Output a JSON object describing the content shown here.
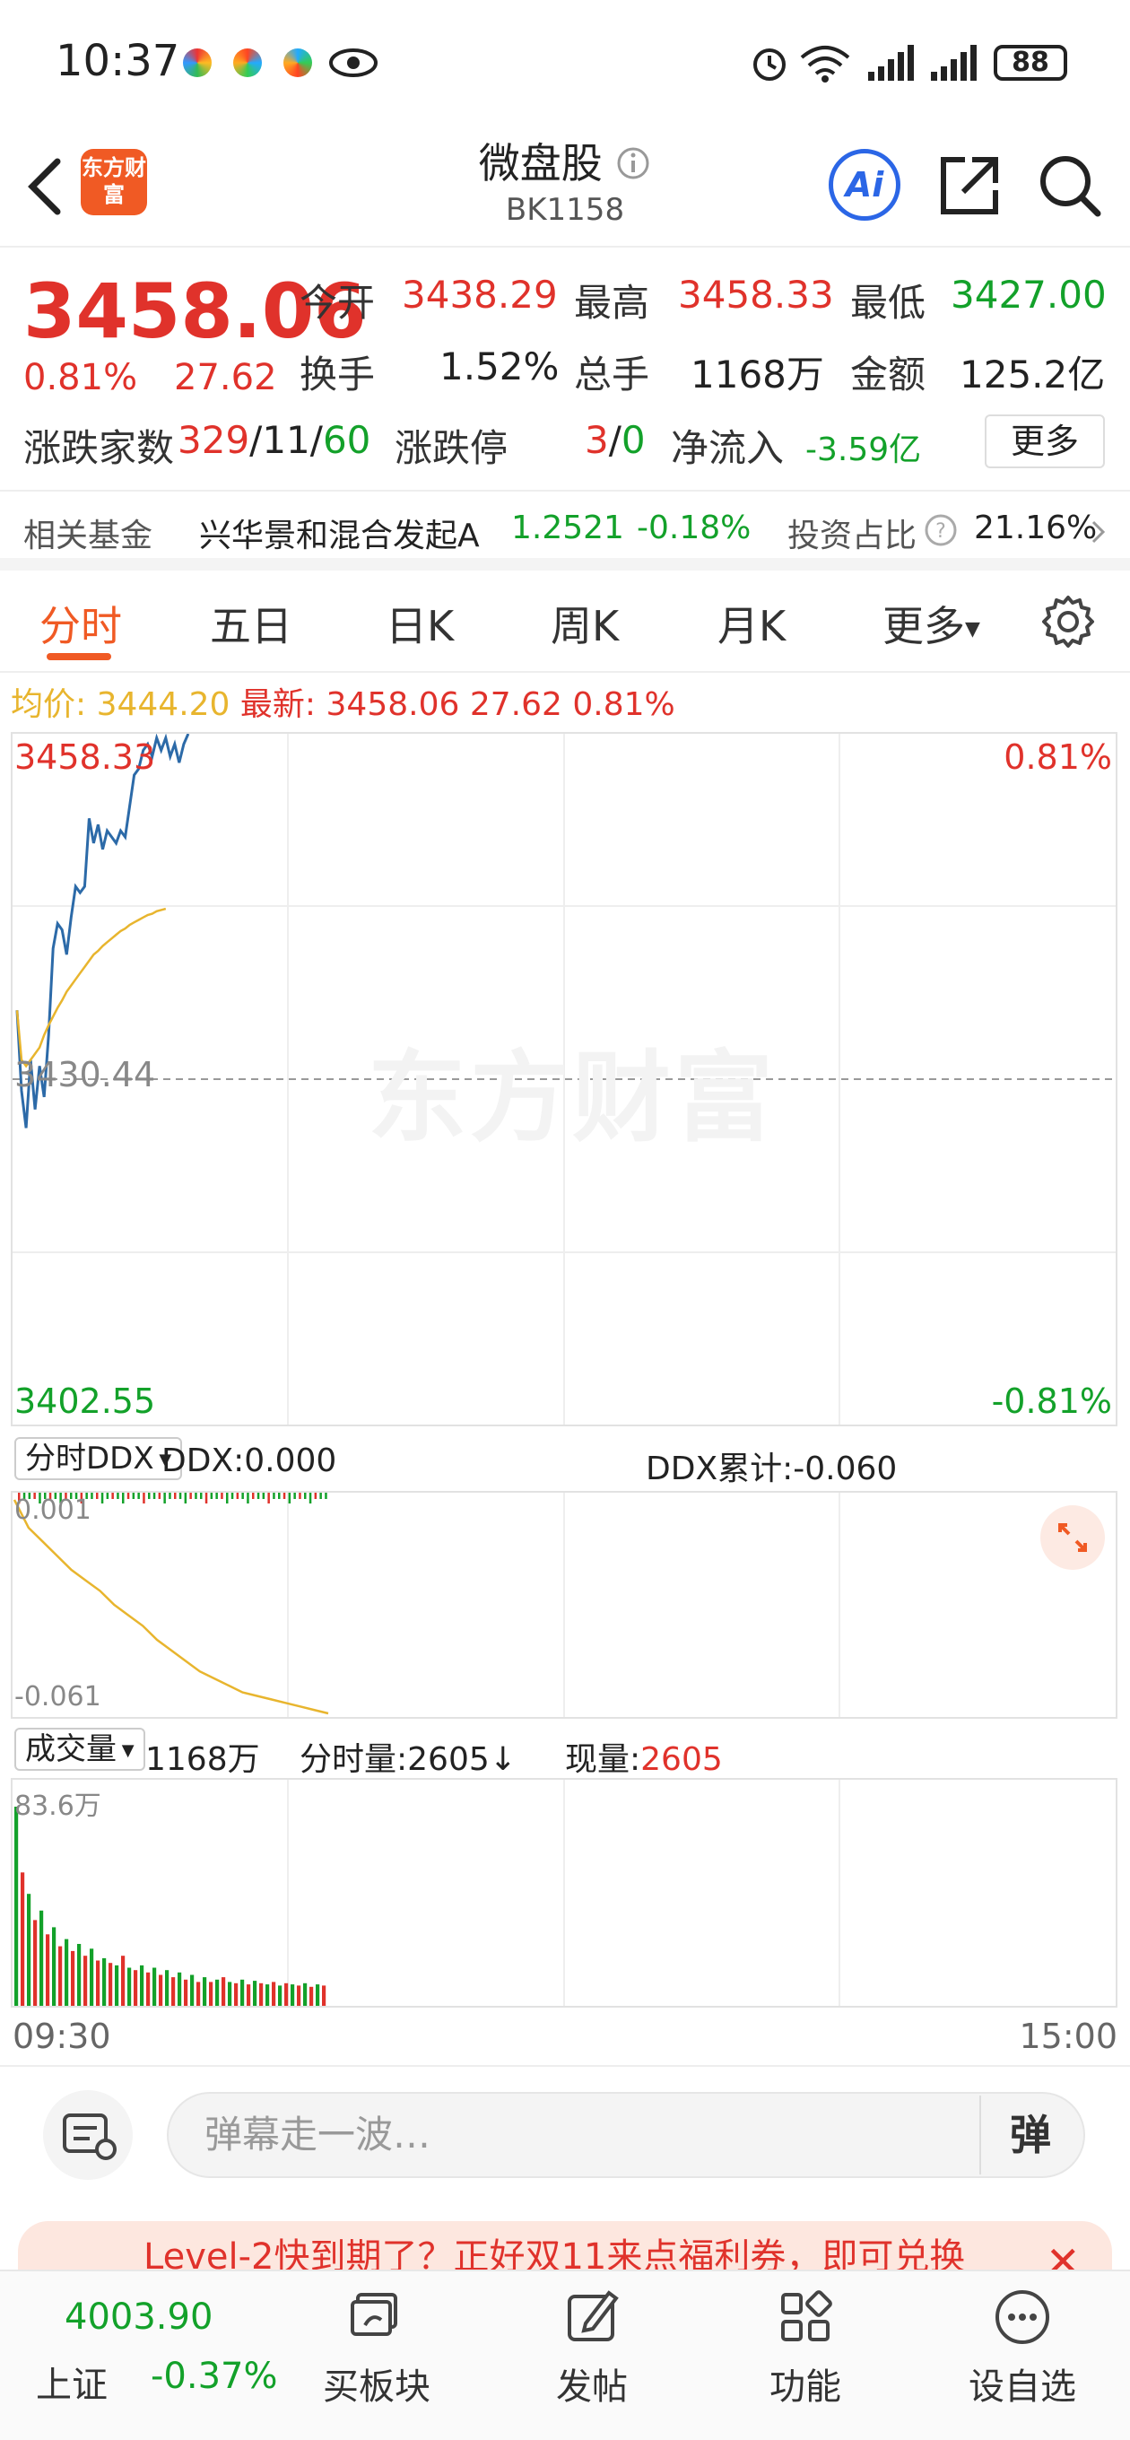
{
  "status_bar": {
    "time": "10:37",
    "battery": "88"
  },
  "header": {
    "logo_text": "东方财富",
    "title": "微盘股",
    "code": "BK1158"
  },
  "quote": {
    "price": "3458.06",
    "change_pct": "0.81%",
    "change": "27.62",
    "open_label": "今开",
    "open": "3438.29",
    "high_label": "最高",
    "high": "3458.33",
    "low_label": "最低",
    "low": "3427.00",
    "turnover_label": "换手",
    "turnover": "1.52%",
    "volume_label": "总手",
    "volume": "1168万",
    "amount_label": "金额",
    "amount": "125.2亿",
    "breadth_label": "涨跌家数",
    "up": "329",
    "flat": "11",
    "down": "60",
    "limit_label": "涨跌停",
    "limit_up": "3",
    "limit_down": "0",
    "netflow_label": "净流入",
    "netflow": "-3.59亿",
    "more_label": "更多"
  },
  "fund": {
    "label": "相关基金",
    "name": "兴华景和混合发起A",
    "nav": "1.2521",
    "chg": "-0.18%",
    "ratio_label": "投资占比",
    "ratio": "21.16%"
  },
  "tabs": [
    "分时",
    "五日",
    "日K",
    "周K",
    "月K",
    "更多"
  ],
  "info_line": {
    "avg_label": "均价:",
    "avg": "3444.20",
    "latest_label": "最新:",
    "latest": "3458.06",
    "chg": "27.62",
    "pct": "0.81%"
  },
  "price_chart": {
    "y_top": "3458.33",
    "y_mid": "3430.44",
    "y_bottom": "3402.55",
    "pct_top": "0.81%",
    "pct_bottom": "-0.81%",
    "watermark": "东方财富",
    "time_start": "09:30",
    "time_end": "15:00"
  },
  "ddx_panel": {
    "dropdown": "分时DDX",
    "ddx_label": "DDX:0.000",
    "cum_label": "DDX累计:-0.060",
    "top_val": "0.001",
    "bottom_val": "-0.061"
  },
  "volume_panel": {
    "dropdown": "成交量",
    "total": "1168万",
    "period_label": "分时量:2605↓",
    "current_label": "现量:",
    "current": "2605",
    "max_label": "83.6万"
  },
  "danmu": {
    "placeholder": "弹幕走一波…",
    "send": "弹"
  },
  "promo": {
    "text": "Level-2快到期了？正好双11来点福利券，即可兑换"
  },
  "bottom_nav": {
    "index_value": "4003.90",
    "index_name": "上证",
    "index_chg": "-0.37%",
    "items": [
      "买板块",
      "发帖",
      "功能",
      "设自选"
    ]
  },
  "colors": {
    "up": "#e0322b",
    "down": "#13a12a",
    "accent": "#f05a24",
    "avg_line": "#e8b52e",
    "price_line": "#2c6aa8"
  },
  "chart_data": [
    {
      "type": "line",
      "title": "",
      "xlabel": "",
      "ylabel": "",
      "x_range": [
        "09:30",
        "15:00"
      ],
      "ylim": [
        3402.55,
        3458.33
      ],
      "reference": 3430.44,
      "series": [
        {
          "values": [
            3436.0,
            3429.5,
            3426.5,
            3432.0,
            3428.0,
            3431.5,
            3429.0,
            3434.0,
            3441.0,
            3443.0,
            3442.5,
            3440.5,
            3443.5,
            3446.0,
            3445.5,
            3446.0,
            3451.5,
            3449.5,
            3451.0,
            3449.0,
            3450.5,
            3450.0,
            3449.5,
            3450.5,
            3450.0,
            3452.5,
            3455.0,
            3455.5,
            3457.0,
            3457.5,
            3456.5,
            3458.0,
            3457.0,
            3458.0,
            3456.5,
            3457.5,
            3456.0,
            3457.5,
            3458.33
          ]
        },
        {
          "values": [
            3436.0,
            3432.0,
            3431.5,
            3432.0,
            3432.5,
            3433.0,
            3434.0,
            3434.8,
            3435.5,
            3436.2,
            3436.8,
            3437.5,
            3438.0,
            3438.5,
            3439.0,
            3439.5,
            3440.0,
            3440.5,
            3440.8,
            3441.2,
            3441.5,
            3441.8,
            3442.1,
            3442.4,
            3442.6,
            3442.9,
            3443.1,
            3443.3,
            3443.5,
            3443.7,
            3443.8,
            3444.0,
            3444.1,
            3444.2
          ]
        }
      ]
    },
    {
      "type": "line",
      "title": "",
      "ylim": [
        -0.061,
        0.001
      ],
      "series": [
        {
          "values": [
            0.0,
            -0.008,
            -0.012,
            -0.016,
            -0.02,
            -0.023,
            -0.026,
            -0.03,
            -0.033,
            -0.036,
            -0.04,
            -0.043,
            -0.046,
            -0.049,
            -0.051,
            -0.053,
            -0.055,
            -0.056,
            -0.057,
            -0.058,
            -0.059,
            -0.06,
            -0.061
          ]
        }
      ]
    },
    {
      "type": "bar",
      "title": "",
      "ylim": [
        0,
        836000
      ],
      "series": [
        {
          "values": [
            836000,
            560000,
            470000,
            360000,
            400000,
            300000,
            330000,
            250000,
            280000,
            230000,
            260000,
            210000,
            240000,
            190000,
            200000,
            180000,
            170000,
            210000,
            160000,
            150000,
            170000,
            140000,
            160000,
            130000,
            150000,
            120000,
            140000,
            110000,
            130000,
            100000,
            120000,
            100000,
            110000,
            120000,
            100000,
            95000,
            110000,
            90000,
            105000,
            95000,
            90000,
            100000,
            85000,
            95000,
            90000,
            85000,
            95000,
            80000,
            90000,
            85000
          ]
        }
      ]
    }
  ]
}
